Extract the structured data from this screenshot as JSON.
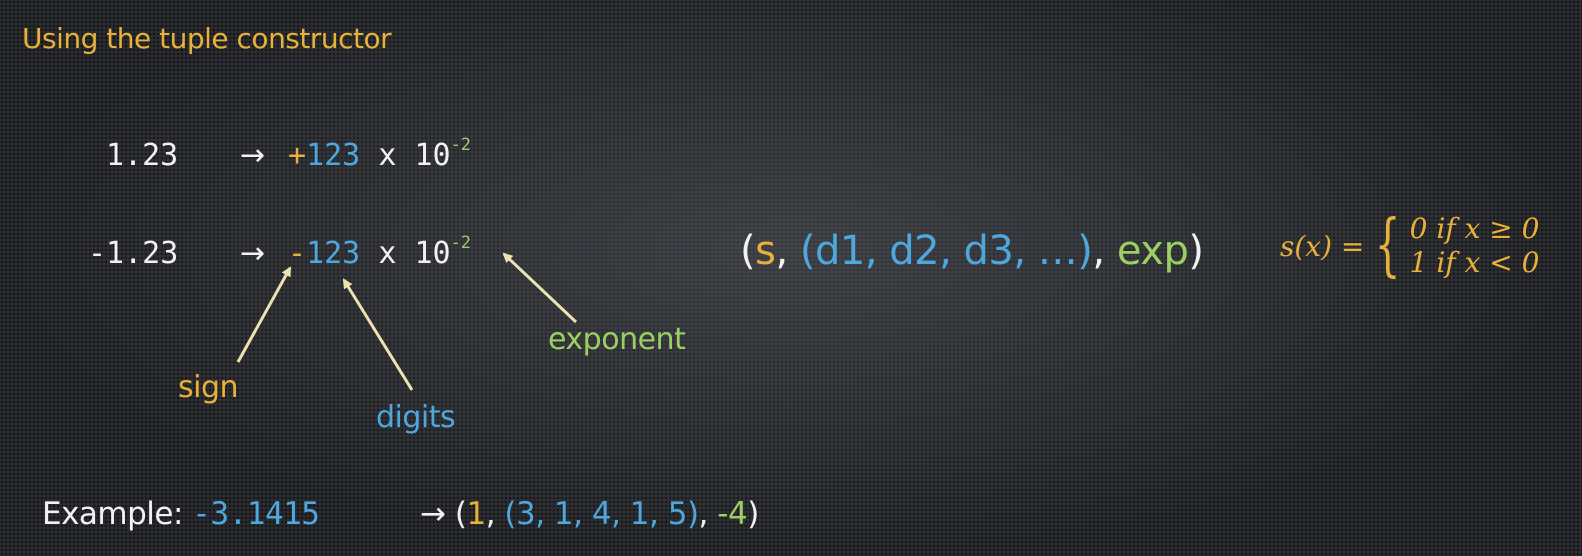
{
  "title": "Using the tuple constructor",
  "row1": {
    "value": "1.23",
    "arrow": "→",
    "sign": "+",
    "digits": "123",
    "times": "x",
    "base": "10",
    "exp": "-2"
  },
  "row2": {
    "value": "-1.23",
    "arrow": "→",
    "sign": "-",
    "digits": "123",
    "times": "x",
    "base": "10",
    "exp": "-2"
  },
  "labels": {
    "sign": "sign",
    "digits": "digits",
    "exponent": "exponent"
  },
  "tuple": {
    "open": "(",
    "s": "s",
    "comma1": ",",
    "digits": "(d1, d2, d3, …)",
    "comma2": ",",
    "exp": "exp",
    "close": ")"
  },
  "formula": {
    "lhs": "s(x) =",
    "case1": "0  if x ≥ 0",
    "case2": "1  if x < 0"
  },
  "example": {
    "label": "Example:",
    "value": "-3.1415",
    "arrow": "→",
    "open": "(",
    "sign": "1",
    "comma1": ",",
    "digits": "(3, 1, 4, 1, 5)",
    "comma2": ",",
    "exp": "-4",
    "close": ")"
  },
  "colors": {
    "sign": "#e8b23a",
    "digits": "#4ea7dd",
    "exponent": "#9ccf63",
    "text": "#f2f2f2"
  }
}
